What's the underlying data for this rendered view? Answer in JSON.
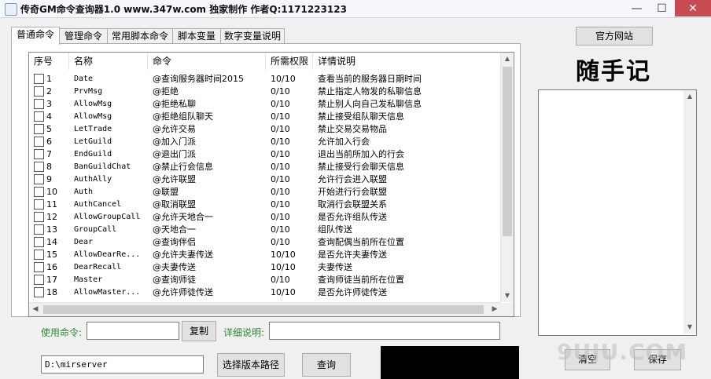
{
  "window": {
    "title": "传奇GM命令查询器1.0 www.347w.com 独家制作 作者Q:1171223123",
    "min_glyph": "—",
    "max_glyph": "☐",
    "close_glyph": "✕"
  },
  "tabs": [
    "普通命令",
    "管理命令",
    "常用脚本命令",
    "脚本变量",
    "数字变量说明"
  ],
  "table": {
    "columns": [
      "序号",
      "名称",
      "命令",
      "所需权限",
      "详情说明"
    ],
    "rows": [
      {
        "no": "1",
        "name": "Date",
        "cmd": "@查询服务器时间2015",
        "perm": "10/10",
        "desc": "查看当前的服务器日期时间"
      },
      {
        "no": "2",
        "name": "PrvMsg",
        "cmd": "@拒绝",
        "perm": "0/10",
        "desc": "禁止指定人物发的私聊信息"
      },
      {
        "no": "3",
        "name": "AllowMsg",
        "cmd": "@拒绝私聊",
        "perm": "0/10",
        "desc": "禁止别人向自己发私聊信息"
      },
      {
        "no": "4",
        "name": "AllowMsg",
        "cmd": "@拒绝组队聊天",
        "perm": "0/10",
        "desc": "禁止接受组队聊天信息"
      },
      {
        "no": "5",
        "name": "LetTrade",
        "cmd": "@允许交易",
        "perm": "0/10",
        "desc": "禁止交易交易物品"
      },
      {
        "no": "6",
        "name": "LetGuild",
        "cmd": "@加入门派",
        "perm": "0/10",
        "desc": "允许加入行会"
      },
      {
        "no": "7",
        "name": "EndGuild",
        "cmd": "@退出门派",
        "perm": "0/10",
        "desc": "退出当前所加入的行会"
      },
      {
        "no": "8",
        "name": "BanGuildChat",
        "cmd": "@禁止行会信息",
        "perm": "0/10",
        "desc": "禁止接受行会聊天信息"
      },
      {
        "no": "9",
        "name": "AuthAlly",
        "cmd": "@允许联盟",
        "perm": "0/10",
        "desc": "允许行会进入联盟"
      },
      {
        "no": "10",
        "name": "Auth",
        "cmd": "@联盟",
        "perm": "0/10",
        "desc": "开始进行行会联盟"
      },
      {
        "no": "11",
        "name": "AuthCancel",
        "cmd": "@取消联盟",
        "perm": "0/10",
        "desc": "取消行会联盟关系"
      },
      {
        "no": "12",
        "name": "AllowGroupCall",
        "cmd": "@允许天地合一",
        "perm": "0/10",
        "desc": "是否允许组队传送"
      },
      {
        "no": "13",
        "name": "GroupCall",
        "cmd": "@天地合一",
        "perm": "0/10",
        "desc": "组队传送"
      },
      {
        "no": "14",
        "name": "Dear",
        "cmd": "@查询伴侣",
        "perm": "0/10",
        "desc": "查询配偶当前所在位置"
      },
      {
        "no": "15",
        "name": "AllowDearRe...",
        "cmd": "@允许夫妻传送",
        "perm": "10/10",
        "desc": "是否允许夫妻传送"
      },
      {
        "no": "16",
        "name": "DearRecall",
        "cmd": "@夫妻传送",
        "perm": "10/10",
        "desc": "夫妻传送"
      },
      {
        "no": "17",
        "name": "Master",
        "cmd": "@查询师徒",
        "perm": "0/10",
        "desc": "查询师徒当前所在位置"
      },
      {
        "no": "18",
        "name": "AllowMaster...",
        "cmd": "@允许师徒传送",
        "perm": "10/10",
        "desc": "是否允许师徒传送"
      }
    ]
  },
  "controls": {
    "use_cmd_label": "使用命令:",
    "use_cmd_value": "",
    "copy_button": "复制",
    "detail_label": "详细说明:",
    "detail_value": "",
    "path_value": "D:\\mirserver",
    "select_path_button": "选择版本路径",
    "query_button": "查询"
  },
  "right_panel": {
    "website_button": "官方网站",
    "heading": "随手记",
    "notes_value": "",
    "clear_button": "清空",
    "save_button": "保存"
  },
  "watermark": "9UJU.COM"
}
